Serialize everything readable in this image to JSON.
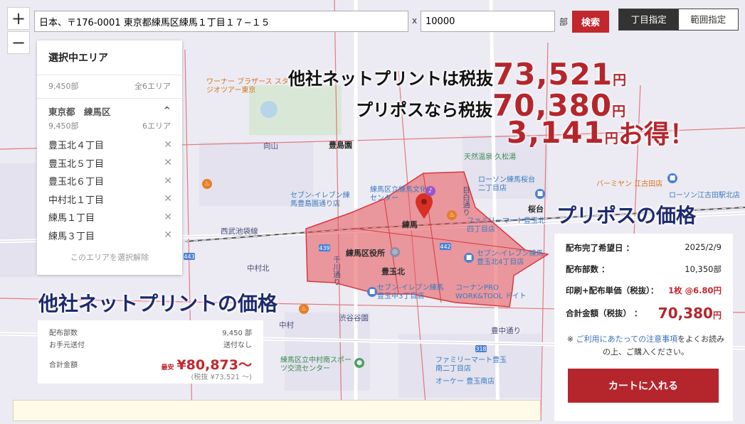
{
  "search": {
    "address": "日本、〒176-0001 東京都練馬区練馬１丁目１７−１５",
    "separator": "x",
    "quantity": "10000",
    "quantity_unit": "部",
    "search_label": "検索",
    "zoom_in": "+",
    "zoom_out": "−"
  },
  "mode": {
    "chome": "丁目指定",
    "range": "範囲指定"
  },
  "area_panel": {
    "title": "選択中エリア",
    "total_copies": "9,450部",
    "total_areas": "全6エリア",
    "group_name": "東京都　練馬区",
    "group_copies": "9,450部",
    "group_areas": "6エリア",
    "items": [
      "豊玉北４丁目",
      "豊玉北５丁目",
      "豊玉北６丁目",
      "中村北１丁目",
      "練馬１丁目",
      "練馬３丁目"
    ],
    "remove_mark": "✕",
    "collapse_mark": "^",
    "clear_label": "このエリアを選択解除"
  },
  "headline": {
    "line1_text": "他社ネットプリントは税抜",
    "line1_num": "73,521",
    "line2_text": "プリポスなら税抜",
    "line2_num": "70,380",
    "line3_num": "3,141",
    "yen": "円",
    "otoku": "お得！"
  },
  "other": {
    "section_title": "他社ネットプリントの価格",
    "copies_label": "配布部数",
    "copies_value": "9,450 部",
    "shipping_label": "お手元送付",
    "shipping_value": "送付なし",
    "total_label": "合計金額",
    "min_label": "最安",
    "total_value": "¥80,873～",
    "excl_value": "(税抜 ¥73,521 ～)"
  },
  "pripos": {
    "section_title": "プリポスの価格",
    "date_label": "配布完了希望日 ：",
    "date_value": "2025/2/9",
    "copies_label": "配布部数 ：",
    "copies_value": "10,350部",
    "unit_label": "印刷+配布単価（税抜）：",
    "unit_value": "1枚 @6.80円",
    "total_label": "合計金額（税抜） ：",
    "total_value": "70,380",
    "total_yen": "円",
    "note_prefix": "※ ",
    "note_link": "ご利用にあたっての注意事項",
    "note_suffix": "をよくお読みの上、ご購入ください。",
    "cart_label": "カートに入れる"
  },
  "map_labels": {
    "station_nerima": "練馬",
    "station_sakuradai": "桜台",
    "station_toshimaen": "豊島園",
    "station_nerimakasugacho": "向山",
    "toyotamakita": "豊玉北",
    "nakamurakita": "中村北",
    "nakamura": "中村",
    "nerima_kuyakusho": "練馬区役所",
    "bunka_center": "練馬区立練馬文化センター",
    "shibuya_gakuen": "渋谷谷園",
    "sports_center": "練馬区立中村南スポーツ交流センター",
    "toyotama_naka": "豊中通り",
    "sevens_1": "セブン-イレブン練馬豊島園通り店",
    "sevens_2": "セブン-イレブン練馬豊玉北4丁目店",
    "sevens_3": "セブン-イレブン練馬豊玉中3丁目店",
    "family_1": "ファミリーマート豊玉北四丁目店",
    "family_2": "ファミリーマート豊玉南二丁目店",
    "lawson_1": "ローソン練馬桜台二丁目店",
    "lawson_2": "ローソン江古田駅北店",
    "kohnan": "コーナンPRO WORK&TOOL ドイト",
    "onsen": "天然温泉 久松湯",
    "warner": "ワーナー ブラザース スタジオツアー東京",
    "okay": "オーケー 豊玉南店",
    "barmiyan": "バーミヤン 江古田店",
    "sakuradai_road": "目白通り",
    "seibu": "西武池袋線",
    "toyotama_rd": "千川通り"
  }
}
